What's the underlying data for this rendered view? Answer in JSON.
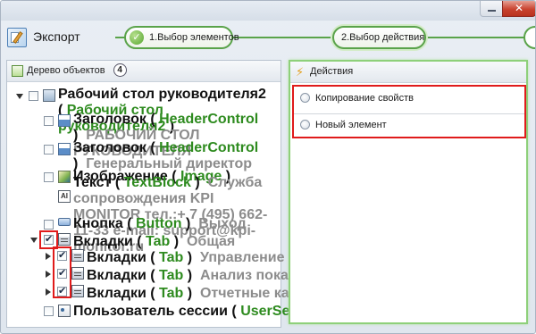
{
  "window": {
    "close_glyph": "✕"
  },
  "header": {
    "title": "Экспорт",
    "steps": [
      {
        "label": "1.Выбор элементов",
        "state": "done"
      },
      {
        "label": "2.Выбор действия",
        "state": "active"
      }
    ],
    "step_done_glyph": "✓"
  },
  "tree_panel": {
    "title": "Дерево объектов",
    "count": "4",
    "nodes": [
      {
        "name": "Рабочий стол руководителя2",
        "open": " ( ",
        "type": "Рабочий стол руководителя2",
        "close": " )",
        "desc": "",
        "checked": false,
        "icon": "desktop-icon"
      },
      {
        "name": "Заголовок",
        "open": " ( ",
        "type": "HeaderControl",
        "close": " )",
        "desc": "РАБОЧИЙ СТОЛ РУКОВОДИТЕЛЯ",
        "checked": false,
        "icon": "header-icon"
      },
      {
        "name": "Заголовок",
        "open": " ( ",
        "type": "HeaderControl",
        "close": " )",
        "desc": "Генеральный директор",
        "checked": false,
        "icon": "header-icon"
      },
      {
        "name": "Изображение",
        "open": " ( ",
        "type": "Image",
        "close": " )",
        "desc": "",
        "checked": false,
        "icon": "image-icon"
      },
      {
        "name": "Текст",
        "open": " ( ",
        "type": "TextBlock",
        "close": " )",
        "desc": "Служба сопровождения KPI MONITOR тел.:+ 7 (495) 662-11-33 e-mail: support@kpi-monitor.ru",
        "checked": false,
        "icon": "text-icon",
        "icon_glyph": "AI"
      },
      {
        "name": "Кнопка",
        "open": " ( ",
        "type": "Button",
        "close": " )",
        "desc": "Выход",
        "checked": false,
        "icon": "button-icon"
      },
      {
        "name": "Вкладки",
        "open": " ( ",
        "type": "Tab",
        "close": " )",
        "desc": "Общая",
        "checked": true,
        "icon": "tab-icon"
      },
      {
        "name": "Вкладки",
        "open": " ( ",
        "type": "Tab",
        "close": " )",
        "desc": "Управление по целям",
        "checked": true,
        "icon": "tab-icon"
      },
      {
        "name": "Вкладки",
        "open": " ( ",
        "type": "Tab",
        "close": " )",
        "desc": "Анализ показателей",
        "checked": true,
        "icon": "tab-icon"
      },
      {
        "name": "Вкладки",
        "open": " ( ",
        "type": "Tab",
        "close": " )",
        "desc": "Отчетные кампании",
        "checked": true,
        "icon": "tab-icon"
      },
      {
        "name": "Пользователь сессии",
        "open": " ( ",
        "type": "UserSessionControl",
        "close": " )",
        "desc": "",
        "checked": false,
        "icon": "user-session-icon"
      }
    ]
  },
  "actions_panel": {
    "title": "Действия",
    "options": [
      {
        "label": "Копирование свойств",
        "selected": false
      },
      {
        "label": "Новый элемент",
        "selected": false
      }
    ]
  },
  "colors": {
    "accent_green": "#5aa34a",
    "type_green": "#2e8b1f",
    "desc_gray": "#8c8c8c",
    "annotation_red": "#e01b1b"
  }
}
